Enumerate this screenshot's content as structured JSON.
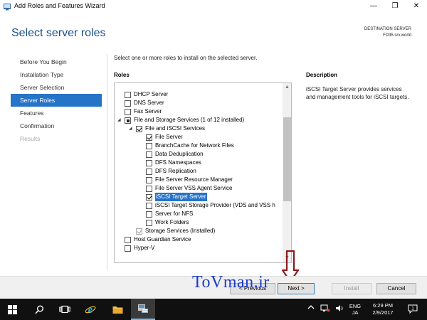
{
  "window": {
    "title": "Add Roles and Features Wizard",
    "minimize_glyph": "—",
    "maximize_glyph": "❐",
    "close_glyph": "✕"
  },
  "header": {
    "page_title": "Select server roles",
    "destination_label": "DESTINATION SERVER",
    "destination_value": "FD35.srv.world"
  },
  "nav": {
    "items": [
      {
        "label": "Before You Begin",
        "state": "normal"
      },
      {
        "label": "Installation Type",
        "state": "normal"
      },
      {
        "label": "Server Selection",
        "state": "normal"
      },
      {
        "label": "Server Roles",
        "state": "active"
      },
      {
        "label": "Features",
        "state": "normal"
      },
      {
        "label": "Confirmation",
        "state": "normal"
      },
      {
        "label": "Results",
        "state": "disabled"
      }
    ]
  },
  "main": {
    "instruction": "Select one or more roles to install on the selected server.",
    "roles_label": "Roles",
    "roles": [
      {
        "label": "DHCP Server",
        "level": 0,
        "state": "unchecked",
        "expander": ""
      },
      {
        "label": "DNS Server",
        "level": 0,
        "state": "unchecked",
        "expander": ""
      },
      {
        "label": "Fax Server",
        "level": 0,
        "state": "unchecked",
        "expander": ""
      },
      {
        "label": "File and Storage Services (1 of 12 installed)",
        "level": 0,
        "state": "partial",
        "expander": "◢"
      },
      {
        "label": "File and iSCSI Services",
        "level": 1,
        "state": "checked",
        "expander": "◢"
      },
      {
        "label": "File Server",
        "level": 2,
        "state": "checked",
        "expander": ""
      },
      {
        "label": "BranchCache for Network Files",
        "level": 2,
        "state": "unchecked",
        "expander": ""
      },
      {
        "label": "Data Deduplication",
        "level": 2,
        "state": "unchecked",
        "expander": ""
      },
      {
        "label": "DFS Namespaces",
        "level": 2,
        "state": "unchecked",
        "expander": ""
      },
      {
        "label": "DFS Replication",
        "level": 2,
        "state": "unchecked",
        "expander": ""
      },
      {
        "label": "File Server Resource Manager",
        "level": 2,
        "state": "unchecked",
        "expander": ""
      },
      {
        "label": "File Server VSS Agent Service",
        "level": 2,
        "state": "unchecked",
        "expander": ""
      },
      {
        "label": "iSCSI Target Server",
        "level": 2,
        "state": "checked",
        "expander": "",
        "selected": true
      },
      {
        "label": "iSCSI Target Storage Provider (VDS and VSS h",
        "level": 2,
        "state": "unchecked",
        "expander": ""
      },
      {
        "label": "Server for NFS",
        "level": 2,
        "state": "unchecked",
        "expander": ""
      },
      {
        "label": "Work Folders",
        "level": 2,
        "state": "unchecked",
        "expander": ""
      },
      {
        "label": "Storage Services (Installed)",
        "level": 1,
        "state": "checked-grey",
        "expander": ""
      },
      {
        "label": "Host Guardian Service",
        "level": 0,
        "state": "unchecked",
        "expander": ""
      },
      {
        "label": "Hyper-V",
        "level": 0,
        "state": "unchecked",
        "expander": ""
      }
    ],
    "description_label": "Description",
    "description_text": "iSCSI Target Server provides services and management tools for iSCSI targets."
  },
  "buttons": {
    "previous": "< Previous",
    "next": "Next >",
    "install": "Install",
    "cancel": "Cancel"
  },
  "watermark": "ToVman.ir",
  "taskbar": {
    "tray_lang_top": "ENG",
    "tray_lang_bottom": "JA",
    "time": "6:29 PM",
    "date": "2/9/2017",
    "notification_count": "1"
  },
  "colors": {
    "accent": "#2674c7",
    "title_blue": "#1a4f8b",
    "watermark_blue": "#1e3cc8",
    "arrow_red": "#8b1a1a",
    "taskbar": "#101010"
  }
}
